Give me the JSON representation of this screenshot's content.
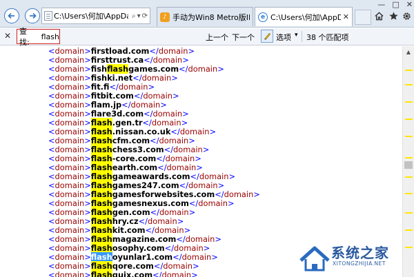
{
  "window": {
    "controls": [
      "—",
      "□",
      "✕"
    ]
  },
  "address_bar": {
    "url": "C:\\Users\\何加\\AppDa",
    "search_glyph": "⌕",
    "dropdown_glyph": "▾",
    "refresh_glyph": "⟳"
  },
  "tabs": [
    {
      "title": "手动为Win8 Metro版IE10...",
      "icon": "site-favicon-icon",
      "active": false
    },
    {
      "title": "C:\\Users\\何加\\AppDat...",
      "icon": "ie-icon",
      "active": true,
      "close": "✕"
    }
  ],
  "toolbar_icons": [
    "home-icon",
    "favorites-star-icon",
    "gear-icon"
  ],
  "find_bar": {
    "close": "✕",
    "label": "查找:",
    "query": "flash",
    "prev_label": "上一个",
    "next_label": "下一个",
    "options_label": "选项",
    "options_caret": "▾",
    "count_label": "38 个匹配项"
  },
  "xml": {
    "open_tag": "<",
    "tag_name": "domain",
    "close_tag_start": "</",
    "tag_end": ">",
    "lines": [
      {
        "pre": "firstload.com",
        "match": "",
        "post": ""
      },
      {
        "pre": "firsttrust.ca",
        "match": "",
        "post": ""
      },
      {
        "pre": "fish",
        "match": "flash",
        "post": "games.com"
      },
      {
        "pre": "fishki.net",
        "match": "",
        "post": ""
      },
      {
        "pre": "fit.fi",
        "match": "",
        "post": ""
      },
      {
        "pre": "fitbit.com",
        "match": "",
        "post": ""
      },
      {
        "pre": "flam.jp",
        "match": "",
        "post": ""
      },
      {
        "pre": "flare3d.com",
        "match": "",
        "post": ""
      },
      {
        "pre": "",
        "match": "flash",
        "post": ".gen.tr"
      },
      {
        "pre": "",
        "match": "flash",
        "post": ".nissan.co.uk"
      },
      {
        "pre": "",
        "match": "flash",
        "post": "cfm.com"
      },
      {
        "pre": "",
        "match": "flash",
        "post": "chess3.com"
      },
      {
        "pre": "",
        "match": "flash",
        "post": "-core.com"
      },
      {
        "pre": "",
        "match": "flash",
        "post": "earth.com"
      },
      {
        "pre": "",
        "match": "flash",
        "post": "gameawards.com"
      },
      {
        "pre": "",
        "match": "flash",
        "post": "games247.com"
      },
      {
        "pre": "",
        "match": "flash",
        "post": "gamesforwebsites.com"
      },
      {
        "pre": "",
        "match": "flash",
        "post": "gamesnexus.com"
      },
      {
        "pre": "",
        "match": "flash",
        "post": "gen.com"
      },
      {
        "pre": "",
        "match": "flash",
        "post": "hry.cz"
      },
      {
        "pre": "",
        "match": "flash",
        "post": "kit.com"
      },
      {
        "pre": "",
        "match": "flash",
        "post": "magazine.com"
      },
      {
        "pre": "",
        "match": "flash",
        "post": "osophy.com"
      },
      {
        "pre": "",
        "match": "flash",
        "post": "oyunlar1.com",
        "active": true
      },
      {
        "pre": "",
        "match": "flash",
        "post": "qore.com"
      },
      {
        "pre": "",
        "match": "flash",
        "post": "quix.com"
      }
    ]
  },
  "scrollbar": {
    "up_glyph": "▲",
    "position_fraction": 0.49
  },
  "watermark": {
    "text": "系统之家",
    "sub": "XITONGZHIJIA.NET"
  },
  "colors": {
    "tag": "#0000ff",
    "tag_name": "#990000",
    "highlight": "#ffff00",
    "active_highlight": "#3399ff",
    "find_box_border": "#d02020"
  }
}
